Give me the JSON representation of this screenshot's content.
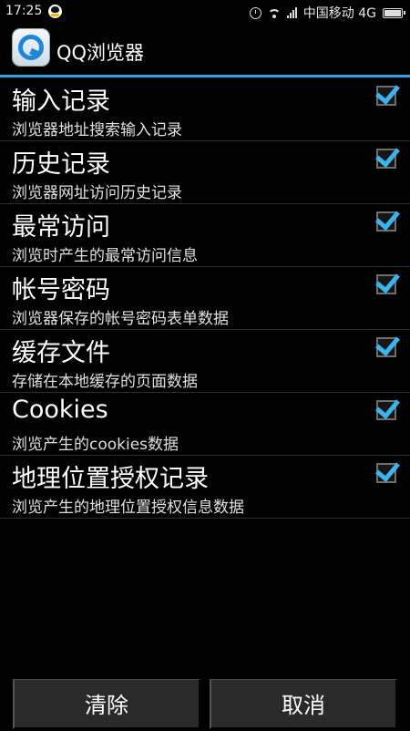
{
  "status_bar": {
    "time": "17:25",
    "carrier": "中国移动 4G",
    "icons": [
      "qq-notification-icon",
      "alarm-icon",
      "wifi-icon",
      "signal-icon",
      "battery-icon"
    ]
  },
  "header": {
    "title": "QQ浏览器",
    "accent_color": "#2fa2e0"
  },
  "items": [
    {
      "title": "输入记录",
      "description": "浏览器地址搜索输入记录",
      "checked": true
    },
    {
      "title": "历史记录",
      "description": "浏览器网址访问历史记录",
      "checked": true
    },
    {
      "title": "最常访问",
      "description": "浏览时产生的最常访问信息",
      "checked": true
    },
    {
      "title": "帐号密码",
      "description": "浏览器保存的帐号密码表单数据",
      "checked": true
    },
    {
      "title": "缓存文件",
      "description": "存储在本地缓存的页面数据",
      "checked": true
    },
    {
      "title": "Cookies",
      "description": "浏览产生的cookies数据",
      "checked": true
    },
    {
      "title": "地理位置授权记录",
      "description": "浏览产生的地理位置授权信息数据",
      "checked": true
    }
  ],
  "buttons": {
    "clear": "清除",
    "cancel": "取消"
  },
  "colors": {
    "checkmark": "#3ab3ee",
    "background": "#000000"
  }
}
